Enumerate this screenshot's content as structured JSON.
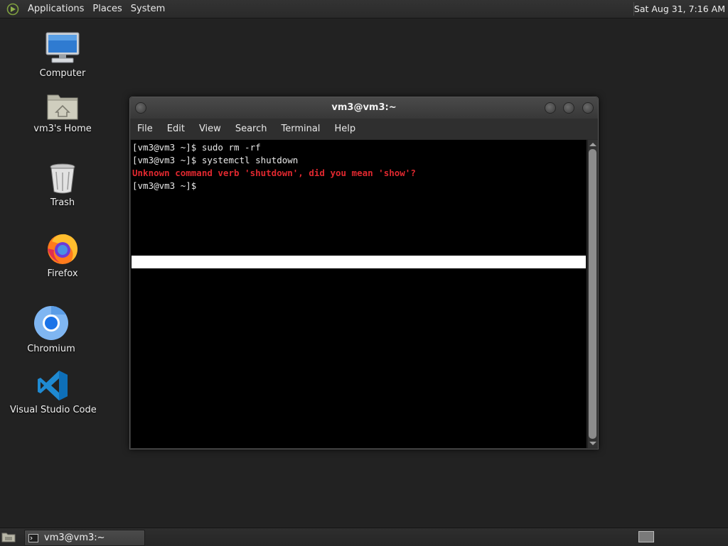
{
  "top_panel": {
    "menus": [
      "Applications",
      "Places",
      "System"
    ],
    "clock": "Sat Aug 31,  7:16 AM"
  },
  "desktop_icons": [
    {
      "label": "Computer",
      "icon": "computer-icon"
    },
    {
      "label": "vm3's Home",
      "icon": "home-folder-icon"
    },
    {
      "label": "Trash",
      "icon": "trash-icon"
    },
    {
      "label": "Firefox",
      "icon": "firefox-icon"
    },
    {
      "label": "Chromium",
      "icon": "chromium-icon"
    },
    {
      "label": "Visual Studio Code",
      "icon": "vscode-icon"
    }
  ],
  "terminal": {
    "title": "vm3@vm3:~",
    "menu": [
      "File",
      "Edit",
      "View",
      "Search",
      "Terminal",
      "Help"
    ],
    "lines": [
      {
        "text": "[vm3@vm3 ~]$ sudo rm -rf",
        "type": "normal"
      },
      {
        "text": "[vm3@vm3 ~]$ systemctl shutdown",
        "type": "normal"
      },
      {
        "text": "Unknown command verb 'shutdown', did you mean 'show'?",
        "type": "error"
      },
      {
        "text": "[vm3@vm3 ~]$",
        "type": "normal"
      }
    ]
  },
  "taskbar": {
    "window_button": "vm3@vm3:~"
  },
  "colors": {
    "desktop_bg": "#222222",
    "terminal_bg": "#000000",
    "error_text": "#e0282f"
  }
}
